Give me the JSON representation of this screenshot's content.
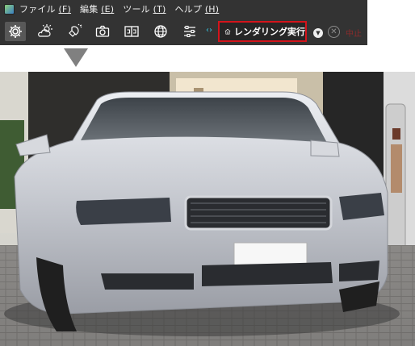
{
  "menu": {
    "items": [
      {
        "label": "ファイル",
        "key": "(F)"
      },
      {
        "label": "編集",
        "key": "(E)"
      },
      {
        "label": "ツール",
        "key": "(T)"
      },
      {
        "label": "ヘルプ",
        "key": "(H)"
      }
    ]
  },
  "toolbar": {
    "tools": [
      "gear-icon",
      "sun-cloud-icon",
      "bulb-icon",
      "camera-icon",
      "stereo-icon",
      "globe-icon",
      "sliders-icon"
    ],
    "render_label": "レンダリング実行",
    "stop_label": "中止"
  },
  "colors": {
    "toolbar_bg": "#333333",
    "render_border": "#d3141b",
    "accent": "#36c4e0"
  }
}
